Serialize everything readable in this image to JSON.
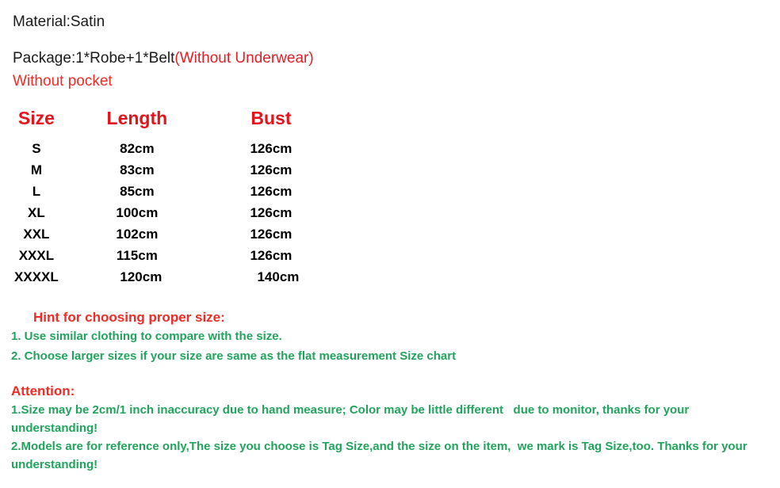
{
  "product_info": {
    "material_line": "Material:Satin",
    "package_label": "Package:1*Robe+1*Belt",
    "package_note": "(Without Underwear)",
    "pocket_note": "Without pocket"
  },
  "size_chart": {
    "headers": [
      "Size",
      "Length",
      "Bust"
    ],
    "rows": [
      {
        "size": "S",
        "length": "82cm",
        "bust": "126cm"
      },
      {
        "size": "M",
        "length": "83cm",
        "bust": "126cm"
      },
      {
        "size": "L",
        "length": "85cm",
        "bust": "126cm"
      },
      {
        "size": "XL",
        "length": "100cm",
        "bust": "126cm"
      },
      {
        "size": "XXL",
        "length": "102cm",
        "bust": "126cm"
      },
      {
        "size": "XXXL",
        "length": "115cm",
        "bust": "126cm"
      },
      {
        "size": "XXXXL",
        "length": "120cm",
        "bust": "140cm"
      }
    ]
  },
  "hint": {
    "title": "Hint for choosing proper size:",
    "items": [
      "1. Use similar clothing to compare with the size.",
      "2. Choose larger sizes if your size are same as the flat measurement Size chart"
    ]
  },
  "attention": {
    "title": "Attention:",
    "items": [
      "1.Size may be 2cm/1 inch inaccuracy due to hand measure; Color may be little different   due to monitor, thanks for your understanding!",
      "2.Models are for reference only,The size you choose is Tag Size,and the size on the item,  we mark is Tag Size,too. Thanks for your understanding!"
    ]
  },
  "colors": {
    "red": "#ee2b25",
    "header_red": "#e4131c",
    "green": "#22a35c",
    "black": "#000000",
    "background": "#ffffff"
  }
}
